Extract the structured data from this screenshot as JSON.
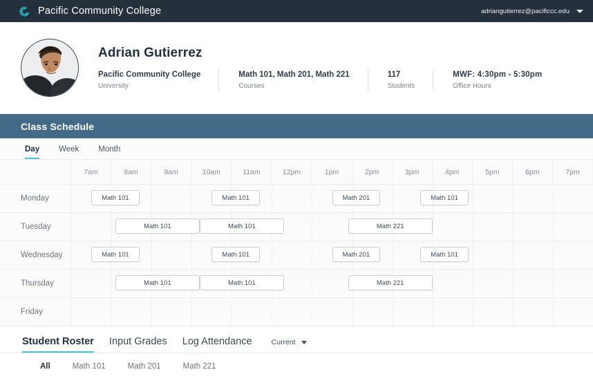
{
  "topnav": {
    "logo_icon": "globe-c-logo-icon",
    "brand": "Pacific Community College",
    "user_email": "adriangutierrez@pacificcc.edu",
    "caret_icon": "chevron-down-icon"
  },
  "profile": {
    "avatar_alt": "avatar-photo",
    "name": "Adrian Gutierrez",
    "stats": [
      {
        "primary": "Pacific Community College",
        "sub": "University"
      },
      {
        "primary": "Math 101, Math 201, Math 221",
        "sub": "Courses"
      },
      {
        "primary": "117",
        "sub": "Students"
      },
      {
        "primary": "MWF: 4:30pm - 5:30pm",
        "sub": "Office Hours"
      }
    ]
  },
  "schedule": {
    "title": "Class Schedule",
    "view_tabs": [
      {
        "label": "Day",
        "active": true
      },
      {
        "label": "Week",
        "active": false
      },
      {
        "label": "Month",
        "active": false
      }
    ],
    "times": [
      "7am",
      "8am",
      "9am",
      "10am",
      "11am",
      "12pm",
      "1pm",
      "2pm",
      "3pm",
      "4pm",
      "5pm",
      "6pm",
      "7pm"
    ],
    "days": [
      "Monday",
      "Tuesday",
      "Wednesday",
      "Thursday",
      "Friday"
    ],
    "events": [
      {
        "day": "Monday",
        "label": "Math 101",
        "start": 0.5,
        "span": 1.2
      },
      {
        "day": "Monday",
        "label": "Math 101",
        "start": 3.5,
        "span": 1.2
      },
      {
        "day": "Monday",
        "label": "Math 201",
        "start": 6.5,
        "span": 1.2
      },
      {
        "day": "Monday",
        "label": "Math 101",
        "start": 8.7,
        "span": 1.2
      },
      {
        "day": "Tuesday",
        "label": "Math 101",
        "start": 1.1,
        "span": 2.1
      },
      {
        "day": "Tuesday",
        "label": "Math 101",
        "start": 3.2,
        "span": 2.1
      },
      {
        "day": "Tuesday",
        "label": "Math 221",
        "start": 6.9,
        "span": 2.1
      },
      {
        "day": "Wednesday",
        "label": "Math 101",
        "start": 0.5,
        "span": 1.2
      },
      {
        "day": "Wednesday",
        "label": "Math 101",
        "start": 3.5,
        "span": 1.2
      },
      {
        "day": "Wednesday",
        "label": "Math 201",
        "start": 6.5,
        "span": 1.2
      },
      {
        "day": "Wednesday",
        "label": "Math 101",
        "start": 8.7,
        "span": 1.2
      },
      {
        "day": "Thursday",
        "label": "Math 101",
        "start": 1.1,
        "span": 2.1
      },
      {
        "day": "Thursday",
        "label": "Math 101",
        "start": 3.2,
        "span": 2.1
      },
      {
        "day": "Thursday",
        "label": "Math 221",
        "start": 6.9,
        "span": 2.1
      }
    ]
  },
  "bottom": {
    "tabs": [
      {
        "label": "Student Roster",
        "active": true
      },
      {
        "label": "Input Grades",
        "active": false
      },
      {
        "label": "Log Attendance",
        "active": false
      }
    ],
    "term": {
      "label": "Current",
      "caret_icon": "chevron-down-icon"
    },
    "filters": [
      {
        "label": "All",
        "active": true
      },
      {
        "label": "Math 101",
        "active": false
      },
      {
        "label": "Math 201",
        "active": false
      },
      {
        "label": "Math 221",
        "active": false
      }
    ]
  },
  "colors": {
    "topnav_bg": "#25303d",
    "panel_bg": "#436b87",
    "accent": "#45c4dd",
    "logo_teal": "#26a8bd"
  }
}
